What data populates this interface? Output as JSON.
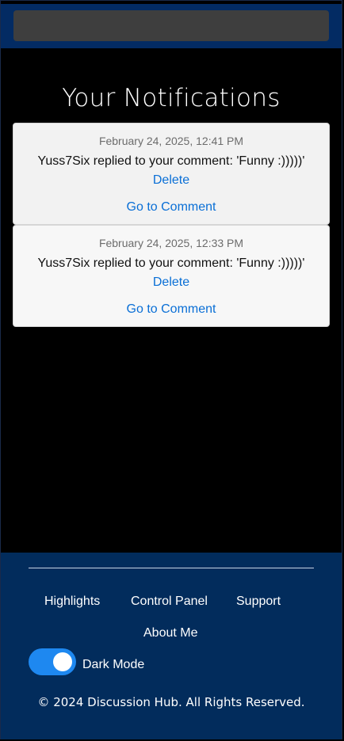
{
  "header": {
    "search_placeholder": ""
  },
  "page": {
    "title": "Your Notifications"
  },
  "notifications": [
    {
      "date": "February 24, 2025, 12:41 PM",
      "message": "Yuss7Six replied to your comment: 'Funny :)))))'",
      "delete_label": "Delete",
      "goto_label": "Go to Comment"
    },
    {
      "date": "February 24, 2025, 12:33 PM",
      "message": "Yuss7Six replied to your comment: 'Funny :)))))'",
      "delete_label": "Delete",
      "goto_label": "Go to Comment"
    }
  ],
  "footer": {
    "links": [
      "Highlights",
      "Control Panel",
      "Support",
      "About Me"
    ],
    "dark_mode_label": "Dark Mode",
    "dark_mode_on": true,
    "copyright": "© 2024 Discussion Hub. All Rights Reserved."
  },
  "colors": {
    "header_bg": "#032b63",
    "footer_bg": "#022c5c",
    "link_blue": "#0a6fd6",
    "toggle_on": "#1e88f0"
  }
}
